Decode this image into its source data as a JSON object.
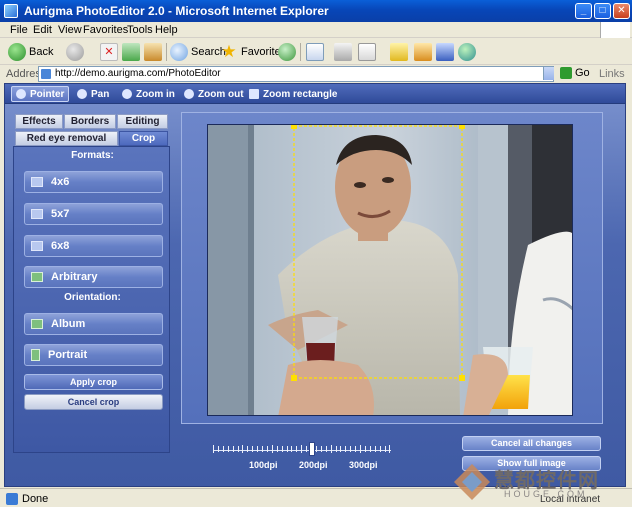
{
  "window": {
    "title": "Aurigma PhotoEditor 2.0 - Microsoft Internet Explorer",
    "minimize": "_",
    "maximize": "□",
    "close": "✕"
  },
  "menu": [
    "File",
    "Edit",
    "View",
    "Favorites",
    "Tools",
    "Help"
  ],
  "toolbar": {
    "back": "Back",
    "search": "Search",
    "favorites": "Favorites"
  },
  "address": {
    "label": "Address",
    "url": "http://demo.aurigma.com/PhotoEditor",
    "go": "Go",
    "links": "Links"
  },
  "editor": {
    "tools": [
      {
        "label": "Pointer",
        "icon": "pointer-icon",
        "active": true
      },
      {
        "label": "Pan",
        "icon": "hand-icon"
      },
      {
        "label": "Zoom in",
        "icon": "zoom-in-icon"
      },
      {
        "label": "Zoom out",
        "icon": "zoom-out-icon"
      },
      {
        "label": "Zoom rectangle",
        "icon": "zoom-rectangle-icon"
      }
    ],
    "tabs_row1": [
      "Effects",
      "Borders",
      "Editing"
    ],
    "tabs_row2": [
      "Red eye removal",
      "Crop"
    ],
    "active_tab": "Crop",
    "formats_header": "Formats:",
    "formats": [
      "4x6",
      "5x7",
      "6x8",
      "Arbitrary"
    ],
    "orientation_header": "Orientation:",
    "orientations": [
      "Album",
      "Portrait"
    ],
    "apply_crop": "Apply crop",
    "cancel_crop": "Cancel crop",
    "zoom_labels": [
      "100dpi",
      "200dpi",
      "300dpi"
    ],
    "zoom_value": "200dpi",
    "cancel_all": "Cancel all changes",
    "show_full": "Show full image"
  },
  "status": {
    "text": "Done",
    "zone": "Local intranet"
  },
  "watermark": {
    "text": "慧都控件网",
    "sub": "HOUGE.COM"
  }
}
